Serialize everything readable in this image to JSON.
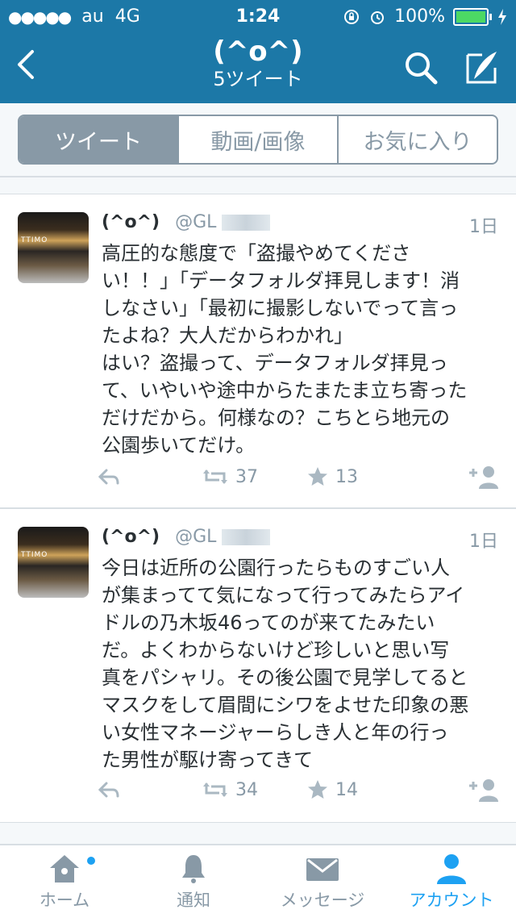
{
  "status_bar": {
    "signal": "●●●●●",
    "carrier": "au",
    "network": "4G",
    "time": "1:24",
    "battery": "100%"
  },
  "nav": {
    "title": "(^o^)",
    "subtitle": "5ツイート"
  },
  "tabs": [
    {
      "label": "ツイート",
      "active": true
    },
    {
      "label": "動画/画像",
      "active": false
    },
    {
      "label": "お気に入り",
      "active": false
    }
  ],
  "tweets": [
    {
      "name": "(^o^)",
      "handle": "@GL",
      "time": "1日",
      "avatar_text": "TTIMO",
      "text": "高圧的な態度で「盗撮やめてくださ\nい！！」「データフォルダ拝見します！消\nしなさい」「最初に撮影しないでって言っ\nたよね？大人だからわかれ」\nはい？盗撮って、データフォルダ拝見っ\nて、いやいや途中からたまたま立ち寄った\nだけだから。何様なの？こちとら地元の\n公園歩いてだけ。",
      "retweets": "37",
      "favorites": "13"
    },
    {
      "name": "(^o^)",
      "handle": "@GL",
      "time": "1日",
      "avatar_text": "TTIMO",
      "text": "今日は近所の公園行ったらものすごい人\nが集まってて気になって行ってみたらアイ\nドルの乃木坂46ってのが来てたみたい\nだ。よくわからないけど珍しいと思い写\n真をパシャリ。その後公園で見学してると\nマスクをして眉間にシワをよせた印象の悪\nい女性マネージャーらしき人と年の行っ\nた男性が駆け寄ってきて",
      "retweets": "34",
      "favorites": "14"
    }
  ],
  "bottom_nav": [
    {
      "label": "ホーム",
      "icon": "home-icon"
    },
    {
      "label": "通知",
      "icon": "bell-icon"
    },
    {
      "label": "メッセージ",
      "icon": "envelope-icon"
    },
    {
      "label": "アカウント",
      "icon": "person-icon",
      "active": true
    }
  ],
  "colors": {
    "header_bg": "#1c78a7",
    "accent": "#1da1f2",
    "muted": "#8899a6"
  }
}
